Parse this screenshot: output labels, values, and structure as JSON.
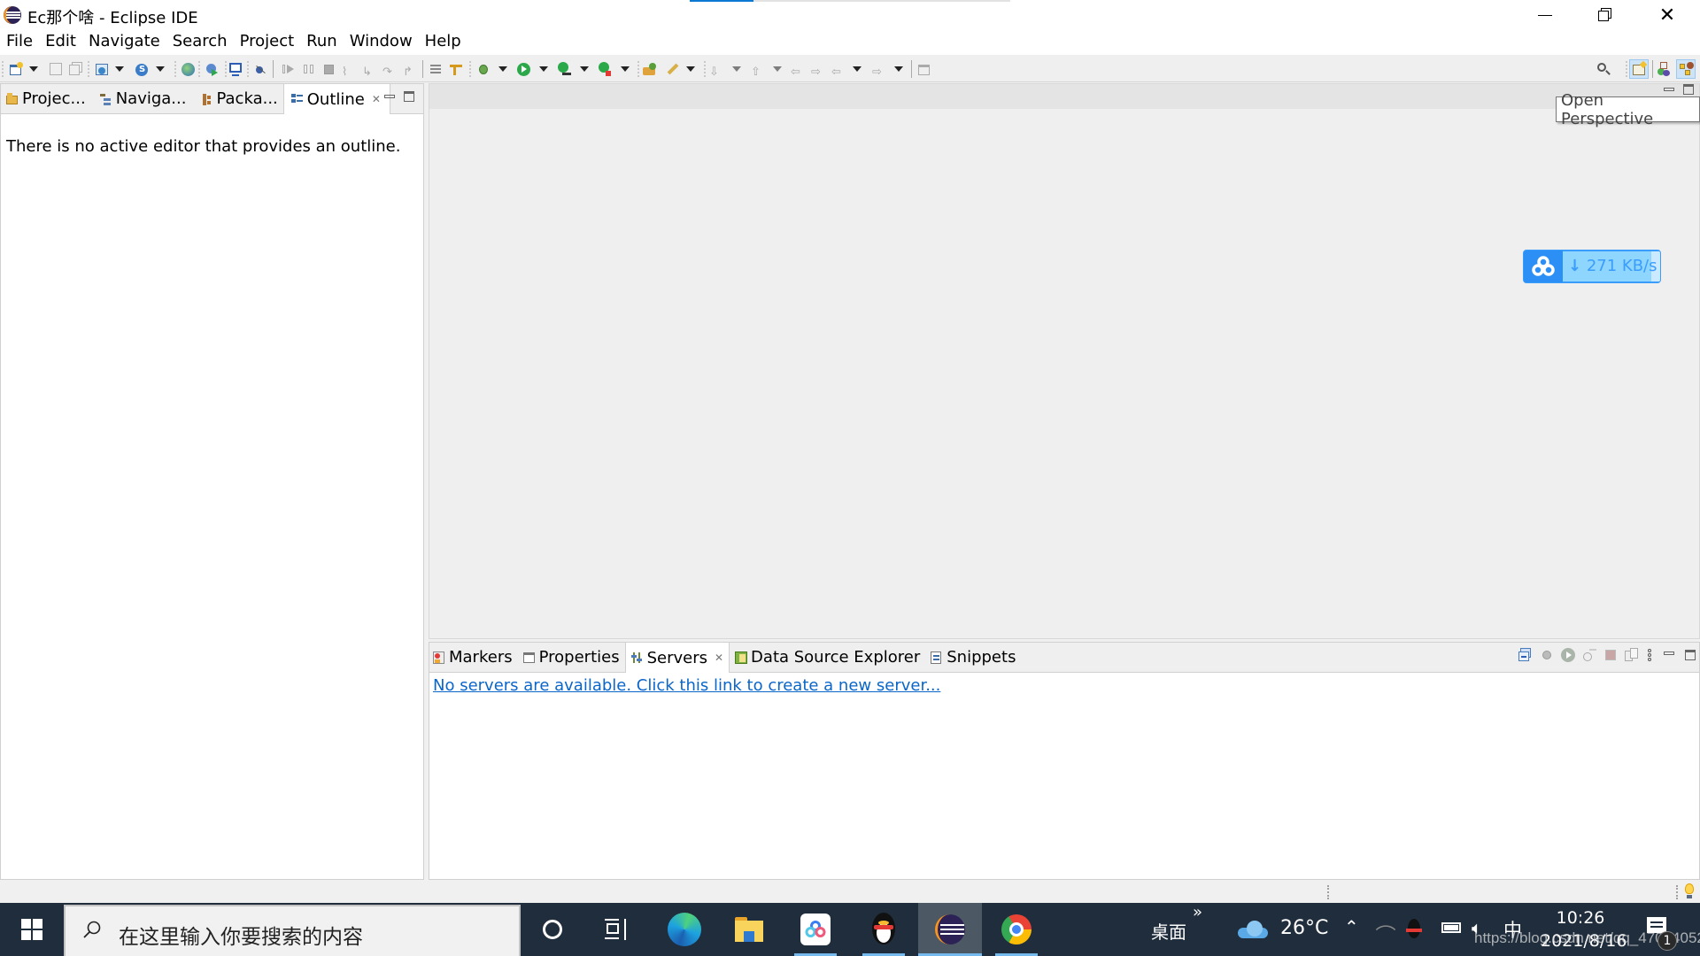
{
  "window": {
    "title": "Ec那个啥 - Eclipse IDE",
    "loading_progress_percent": 20,
    "controls": {
      "minimize": "—",
      "restore": "❐",
      "close": "✕"
    }
  },
  "menubar": {
    "items": [
      "File",
      "Edit",
      "Navigate",
      "Search",
      "Project",
      "Run",
      "Window",
      "Help"
    ]
  },
  "toolbar": {
    "buttons": [
      "new-icon",
      "save-icon",
      "save-all-icon",
      "new-web-service-icon",
      "new-spring-icon",
      "web-browser-icon",
      "run-on-server-icon",
      "console-icon",
      "skip-breakpoints-icon",
      "resume-icon",
      "suspend-icon",
      "terminate-icon",
      "disconnect-icon",
      "step-into-icon",
      "step-over-icon",
      "step-return-icon",
      "toggle-block-icon",
      "mark-occurrences-icon",
      "debug-icon",
      "run-icon",
      "coverage-icon",
      "external-tools-icon",
      "open-type-icon",
      "search-icon",
      "next-annotation-icon",
      "previous-annotation-icon",
      "last-edit-icon",
      "next-edit-icon",
      "back-icon",
      "forward-icon",
      "pin-editor-icon"
    ],
    "right_buttons": [
      "search-icon",
      "open-perspective-icon",
      "java-ee-perspective-icon",
      "java-perspective-icon"
    ]
  },
  "tooltip": {
    "text": "Open Perspective"
  },
  "left_panel": {
    "tabs": [
      {
        "label": "Projec...",
        "icon": "project-explorer-icon"
      },
      {
        "label": "Naviga...",
        "icon": "navigator-icon"
      },
      {
        "label": "Packa...",
        "icon": "package-explorer-icon"
      },
      {
        "label": "Outline",
        "icon": "outline-icon",
        "active": true
      }
    ],
    "message": "There is no active editor that provides an outline."
  },
  "bottom_panel": {
    "tabs": [
      {
        "label": "Markers",
        "icon": "markers-icon"
      },
      {
        "label": "Properties",
        "icon": "properties-icon"
      },
      {
        "label": "Servers",
        "icon": "servers-icon",
        "active": true
      },
      {
        "label": "Data Source Explorer",
        "icon": "data-source-icon"
      },
      {
        "label": "Snippets",
        "icon": "snippets-icon"
      }
    ],
    "link": "No servers are available. Click this link to create a new server...",
    "tools": [
      "collapse-all-icon",
      "debug-server-icon",
      "start-server-icon",
      "profile-server-icon",
      "stop-server-icon",
      "publish-icon",
      "view-menu-icon"
    ]
  },
  "baidu_widget": {
    "speed": "271 KB/s",
    "arrow": "↓"
  },
  "taskbar": {
    "search_placeholder": "在这里输入你要搜索的内容",
    "apps": [
      "cortana",
      "task-view",
      "edge",
      "file-explorer",
      "baidu-netdisk",
      "qq",
      "eclipse",
      "chrome"
    ],
    "desktop_label": "桌面",
    "chevron": "»",
    "weather": "26°C",
    "ime": "中",
    "time": "10:26",
    "date": "2021/8/16",
    "notification_count": "1",
    "watermark": "https://blog.csdn.net/qq_47004052"
  }
}
